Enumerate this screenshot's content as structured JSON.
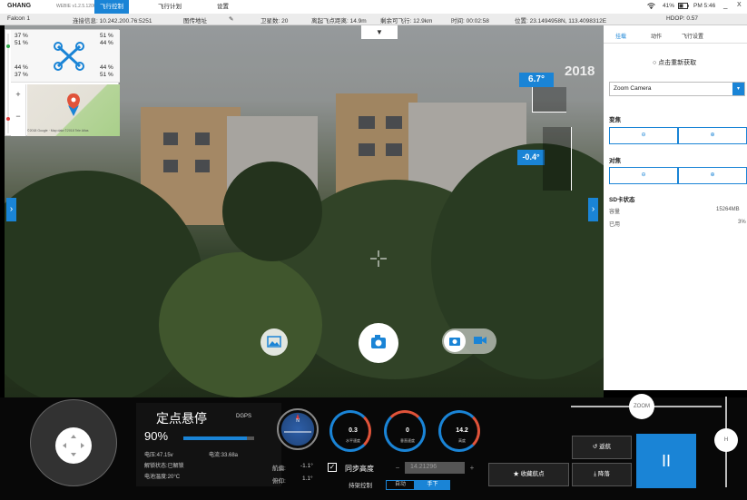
{
  "topbar": {
    "brand": "GHANG",
    "version": "WEBIE v1.2.5.1206",
    "tabs": [
      "飞行控制",
      "飞行计划",
      "设置"
    ],
    "battery_status": "41%",
    "time": "PM 5:46",
    "minimize": "_",
    "close": "X"
  },
  "statusbar": {
    "drone_name": "Falcon 1",
    "connection": "连接信息: 10.242.200.76:5251",
    "video_address": "图传地址",
    "satellites": "卫星数: 20",
    "takeoff_distance": "离起飞点距离: 14.9m",
    "remaining_flight": "剩余可飞行: 12.9km",
    "flight_time": "时间: 00:02:58",
    "position": "位置: 23.1494958N, 113.4098312E",
    "hdop": "HDOP: 0.57"
  },
  "mini_panel": {
    "motors": {
      "top_left": [
        "37 %",
        "51 %"
      ],
      "top_right": [
        "51 %",
        "44 %"
      ],
      "bottom_left": [
        "44 %",
        "37 %"
      ],
      "bottom_right": [
        "44 %",
        "51 %"
      ]
    },
    "map_plus": "+",
    "map_minus": "−",
    "map_attribution": "©2018 Google · Map data ©2018 Tele Atlas"
  },
  "camera": {
    "heading_top": "6.7°",
    "year_overlay": "2018",
    "pitch": "-0.4°",
    "osd_id": "X007",
    "top_expander": "▼",
    "left_expander": "›",
    "right_expander": "›"
  },
  "right_panel": {
    "tabs": [
      "挂载",
      "动作",
      "飞行设置"
    ],
    "refresh": "点击重新获取",
    "camera_select": "Zoom Camera",
    "zoom_section": "变焦",
    "focus_section": "对焦",
    "btn_minus": "⊖",
    "btn_plus": "⊕",
    "sd_title": "SD卡状态",
    "sd_capacity_label": "容量",
    "sd_capacity_value": "15264MB",
    "sd_used_label": "已用",
    "sd_used_value": "3%"
  },
  "flight_status": {
    "mode": "定点悬停",
    "gps": "DGPS",
    "battery": "90%",
    "battery_level": 0.9,
    "voltage": "电压:47.15v",
    "current": "电流:33.68a",
    "unlock": "解锁状态:已解锁",
    "temperature": "电池温度:20°C"
  },
  "gauges": [
    {
      "value": "0.3",
      "label": "水平速度"
    },
    {
      "value": "0",
      "label": "垂直速度"
    },
    {
      "value": "14.2",
      "label": "高度"
    }
  ],
  "attitude": {
    "heading_label": "航偏:",
    "heading_value": "-1.1°",
    "roll_label": "俯仰:",
    "roll_value": "1.1°"
  },
  "controls": {
    "sync_height_check": "✓",
    "sync_height": "同步高度",
    "altitude_minus": "−",
    "altitude_value": "14.21296",
    "altitude_plus": "+",
    "gimbal_label": "持架控制",
    "gimbal_options": [
      "自动",
      "手下"
    ],
    "favorite": "★ 收藏航点",
    "return_home": "↺ 返航",
    "land": "⤓ 降落",
    "pause": "II",
    "zoom_knob": "ZOOM",
    "height_knob": "H"
  }
}
